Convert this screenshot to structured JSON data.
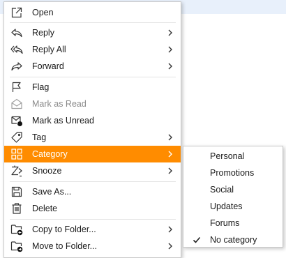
{
  "context_menu": {
    "items": [
      {
        "label": "Open"
      },
      {
        "label": "Reply"
      },
      {
        "label": "Reply All"
      },
      {
        "label": "Forward"
      },
      {
        "label": "Flag"
      },
      {
        "label": "Mark as Read"
      },
      {
        "label": "Mark as Unread"
      },
      {
        "label": "Tag"
      },
      {
        "label": "Category"
      },
      {
        "label": "Snooze"
      },
      {
        "label": "Save As..."
      },
      {
        "label": "Delete"
      },
      {
        "label": "Copy to Folder..."
      },
      {
        "label": "Move to Folder..."
      }
    ]
  },
  "category_submenu": {
    "items": [
      {
        "label": "Personal"
      },
      {
        "label": "Promotions"
      },
      {
        "label": "Social"
      },
      {
        "label": "Updates"
      },
      {
        "label": "Forums"
      },
      {
        "label": "No category",
        "checked": true
      }
    ]
  },
  "colors": {
    "highlight": "#ff8c00",
    "icon": "#333333"
  }
}
